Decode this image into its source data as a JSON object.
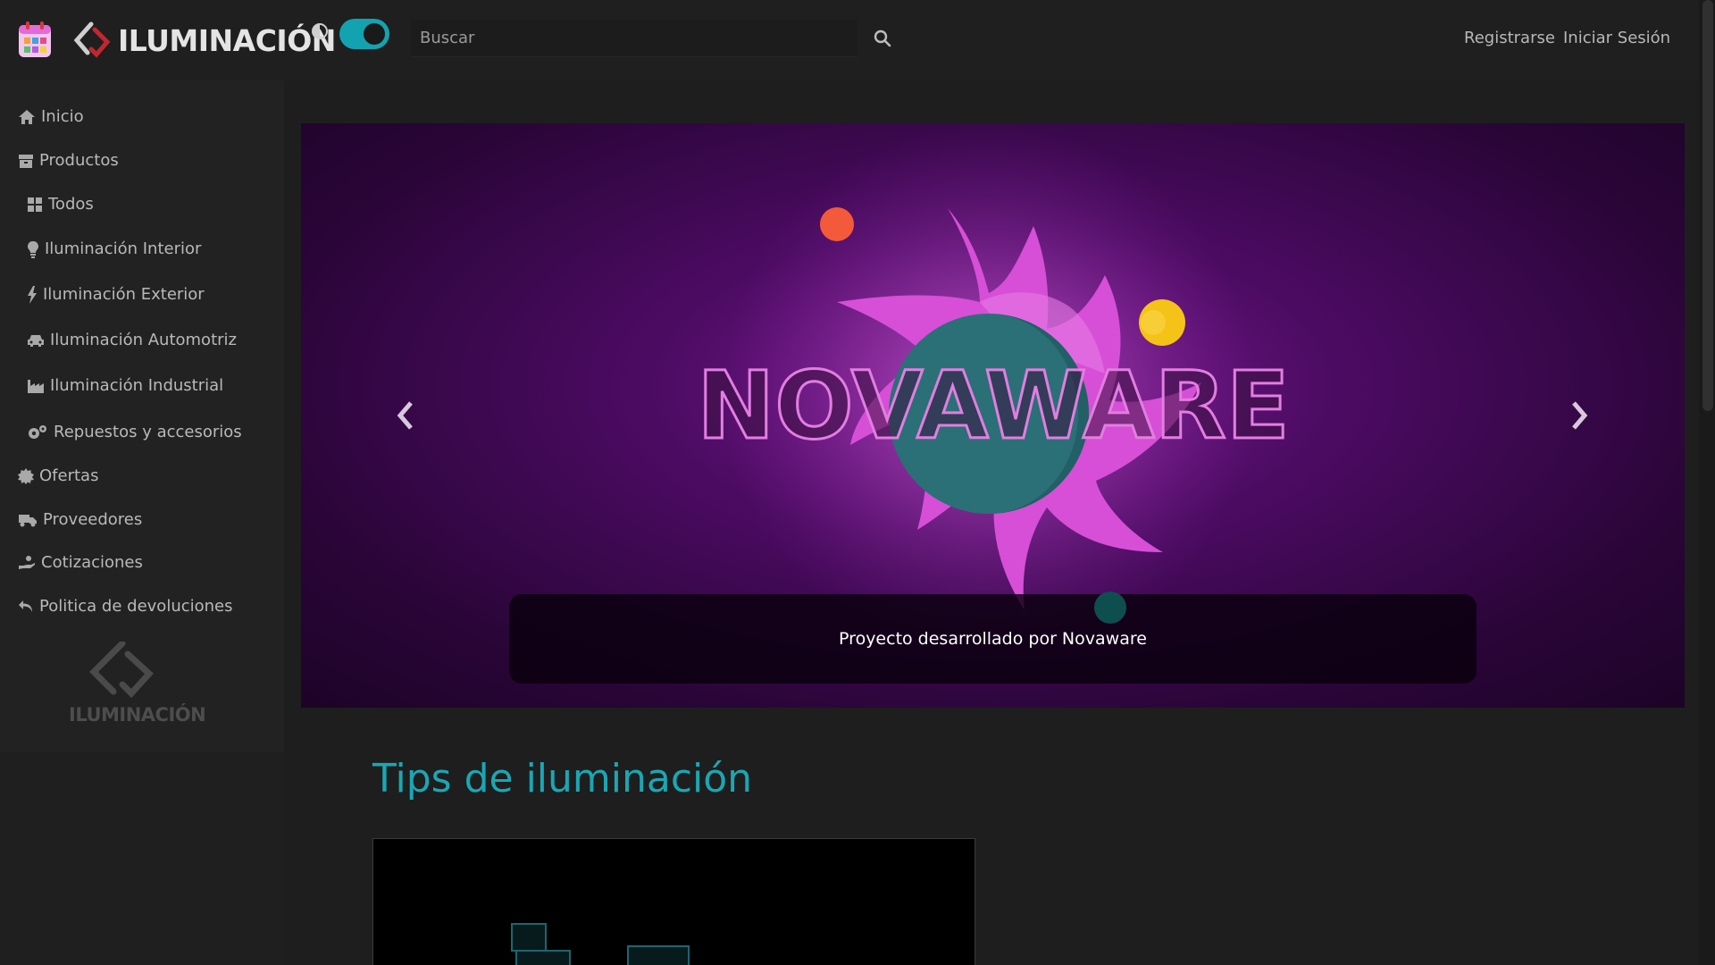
{
  "header": {
    "logo_text": "ILUMINACIÓN",
    "search_placeholder": "Buscar",
    "nav": {
      "register_label": "Registrarse",
      "login_label": "Iniciar Sesión"
    },
    "theme_toggle_on": true
  },
  "sidebar": {
    "items": [
      {
        "label": "Inicio",
        "icon": "home-icon"
      },
      {
        "label": "Productos",
        "icon": "box-icon"
      },
      {
        "label": "Todos",
        "icon": "grid-icon"
      },
      {
        "label": "Iluminación Interior",
        "icon": "lightbulb-icon"
      },
      {
        "label": "Iluminación Exterior",
        "icon": "bolt-icon"
      },
      {
        "label": "Iluminación Automotriz",
        "icon": "car-icon"
      },
      {
        "label": "Iluminación Industrial",
        "icon": "factory-icon"
      },
      {
        "label": "Repuestos y accesorios",
        "icon": "gears-icon"
      },
      {
        "label": "Ofertas",
        "icon": "badge-icon"
      },
      {
        "label": "Proveedores",
        "icon": "truck-icon"
      },
      {
        "label": "Cotizaciones",
        "icon": "hand-coin-icon"
      },
      {
        "label": "Politica de devoluciones",
        "icon": "undo-icon"
      }
    ],
    "footer_logo_text": "ILUMINACIÓN"
  },
  "carousel": {
    "slide_title": "NOVAWARE",
    "caption": "Proyecto desarrollado por Novaware"
  },
  "main": {
    "section_title": "Tips de iluminación"
  },
  "colors": {
    "accent": "#13a3b0",
    "background": "#1f1f1f",
    "sidebar": "#222222",
    "hero_magenta": "#d44fd3"
  }
}
